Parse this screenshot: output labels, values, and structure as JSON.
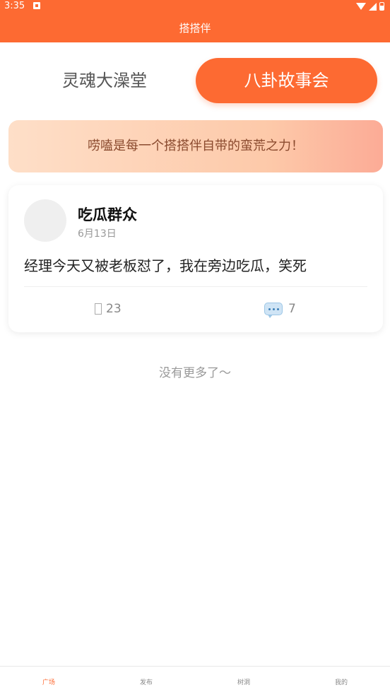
{
  "status_bar": {
    "time": "3:35"
  },
  "header": {
    "title": "搭搭伴"
  },
  "tabs": [
    {
      "label": "灵魂大澡堂",
      "active": false
    },
    {
      "label": "八卦故事会",
      "active": true
    }
  ],
  "banner": {
    "text": "唠嗑是每一个搭搭伴自带的蛮荒之力！"
  },
  "post": {
    "author": "吃瓜群众",
    "date": "6月13日",
    "content": "经理今天又被老板怼了，我在旁边吃瓜，笑死",
    "likes": "23",
    "comments": "7"
  },
  "feed": {
    "end_text": "没有更多了～"
  },
  "bottom_nav": {
    "items": [
      {
        "label": "广场",
        "active": true
      },
      {
        "label": "发布",
        "active": false
      },
      {
        "label": "树洞",
        "active": false
      },
      {
        "label": "我的",
        "active": false
      }
    ]
  },
  "colors": {
    "accent": "#fd6a32",
    "banner_text": "#8a4a2e"
  }
}
